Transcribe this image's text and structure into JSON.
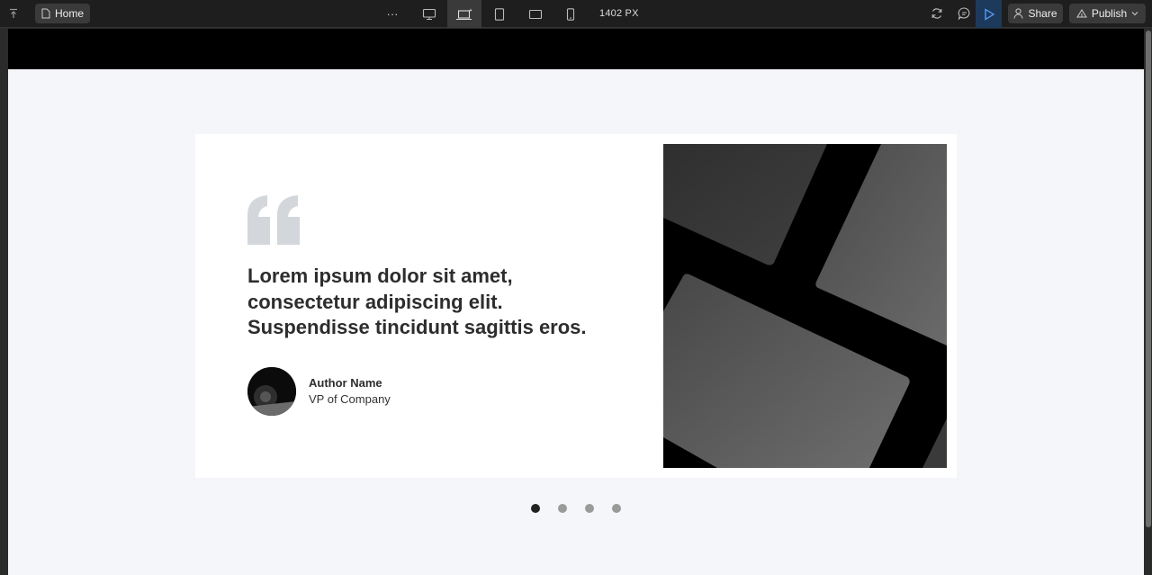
{
  "toolbar": {
    "page_label": "Home",
    "more_label": "···",
    "width_readout": "1402 PX",
    "share_label": "Share",
    "publish_label": "Publish",
    "devices": [
      "desktop",
      "laptop",
      "tablet",
      "tablet-landscape",
      "mobile"
    ],
    "active_device": "laptop"
  },
  "testimonial": {
    "quote": "Lorem ipsum dolor sit amet, consectetur adipiscing elit. Suspendisse tincidunt sagittis eros.",
    "author_name": "Author Name",
    "author_role": "VP of Company"
  },
  "slider": {
    "slide_count": 4,
    "active_slide": 1
  },
  "colors": {
    "toolbar_bg": "#1e1e1e",
    "canvas_bg": "#f5f6fa",
    "play_accent": "#1d3a5c",
    "text_dark": "#2d2d2d",
    "quote_mark": "#d3d6db"
  }
}
